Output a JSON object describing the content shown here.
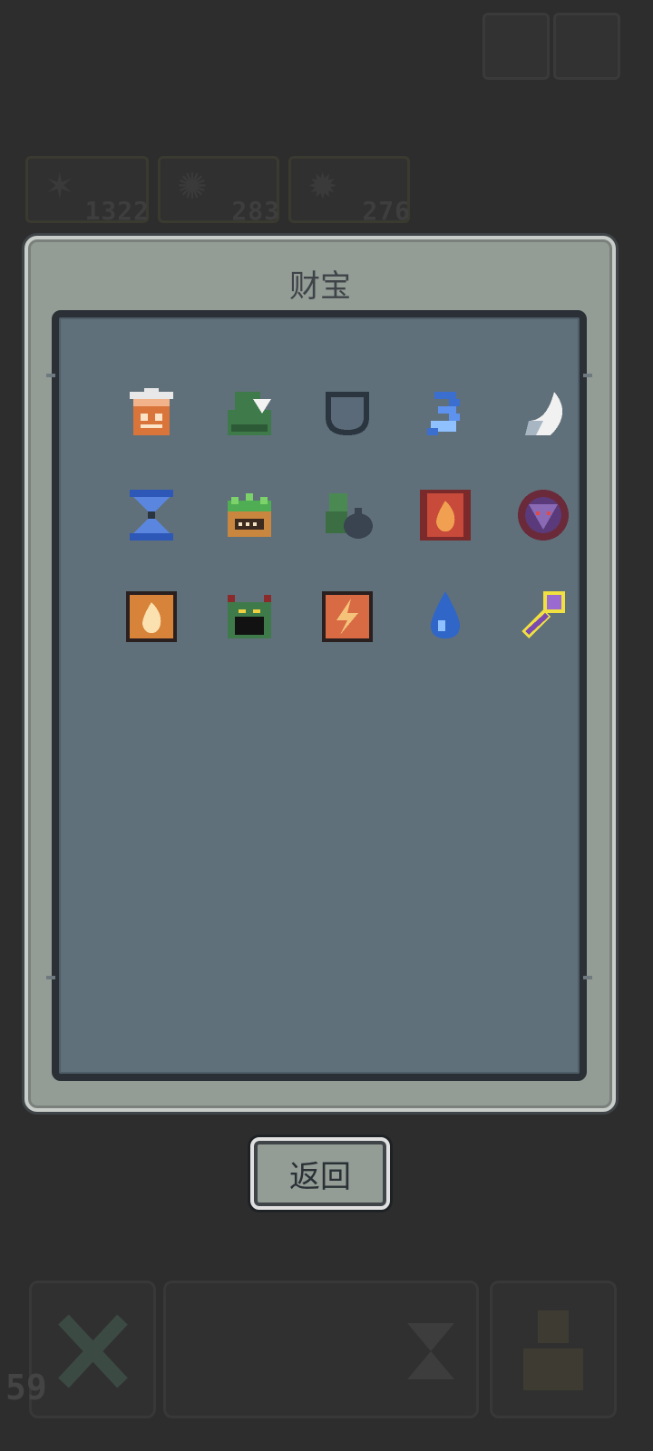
{
  "background": {
    "stats": [
      {
        "icon": "feather-icon",
        "value": "1322"
      },
      {
        "icon": "beetle-icon",
        "value": "283"
      },
      {
        "icon": "demon-icon",
        "value": "276"
      }
    ],
    "level": "59"
  },
  "panel": {
    "title": "财宝",
    "items": [
      {
        "name": "bucket-item-icon"
      },
      {
        "name": "green-cloak-item-icon"
      },
      {
        "name": "iron-shield-item-icon"
      },
      {
        "name": "blue-wind-item-icon"
      },
      {
        "name": "crescent-horn-item-icon"
      },
      {
        "name": "hourglass-item-icon"
      },
      {
        "name": "green-chest-item-icon"
      },
      {
        "name": "goblin-sack-item-icon"
      },
      {
        "name": "fire-tome-item-icon"
      },
      {
        "name": "demon-orb-item-icon"
      },
      {
        "name": "flame-scroll-item-icon"
      },
      {
        "name": "horned-monster-item-icon"
      },
      {
        "name": "lightning-banner-item-icon"
      },
      {
        "name": "water-drop-item-icon"
      },
      {
        "name": "purple-key-item-icon"
      }
    ]
  },
  "back_button": {
    "label": "返回"
  }
}
